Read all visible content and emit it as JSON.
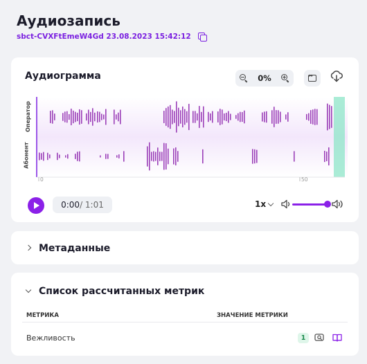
{
  "page": {
    "title": "Аудиозапись",
    "record_id_date": "sbct-CVXFtEmeW4Gd 23.08.2023 15:42:12"
  },
  "audiogram": {
    "title": "Аудиограмма",
    "zoom": "0%",
    "lanes": [
      "Оператор",
      "Абонент"
    ],
    "axis_start": "0",
    "axis_mark": "50",
    "accent_color": "#8b20e8",
    "wave_color": "#9b3fb8",
    "playhead_color": "#7fe0c0"
  },
  "player": {
    "current_time": "0:00",
    "total_time": "/ 1:01",
    "speed": "1x",
    "volume": 1.0
  },
  "metadata_section": {
    "title": "Метаданные"
  },
  "metrics_section": {
    "title": "Список рассчитанных метрик",
    "columns": [
      "Метрика",
      "Значение метрики"
    ],
    "rows": [
      {
        "name": "Вежливость",
        "value": "1"
      }
    ]
  }
}
